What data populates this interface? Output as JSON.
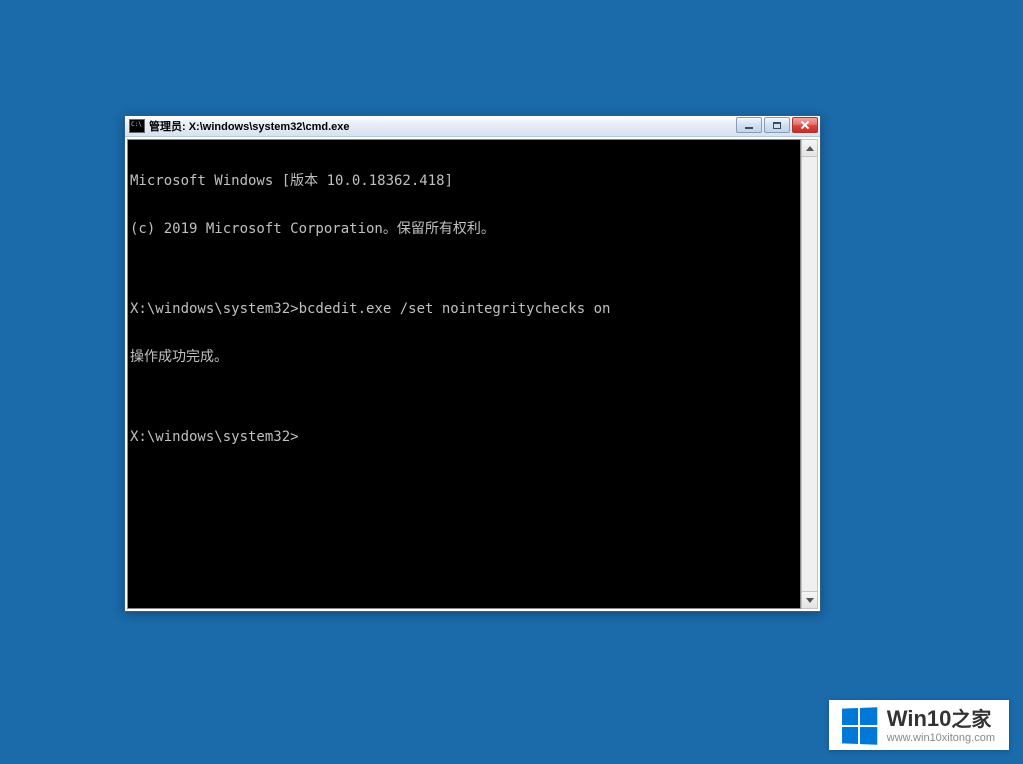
{
  "window": {
    "title": "管理员: X:\\windows\\system32\\cmd.exe"
  },
  "terminal": {
    "lines": [
      "Microsoft Windows [版本 10.0.18362.418]",
      "(c) 2019 Microsoft Corporation。保留所有权利。",
      "",
      "X:\\windows\\system32>bcdedit.exe /set nointegritychecks on",
      "操作成功完成。",
      "",
      "X:\\windows\\system32>"
    ]
  },
  "watermark": {
    "title_prefix": "Win10",
    "title_suffix": "之家",
    "url": "www.win10xitong.com"
  }
}
